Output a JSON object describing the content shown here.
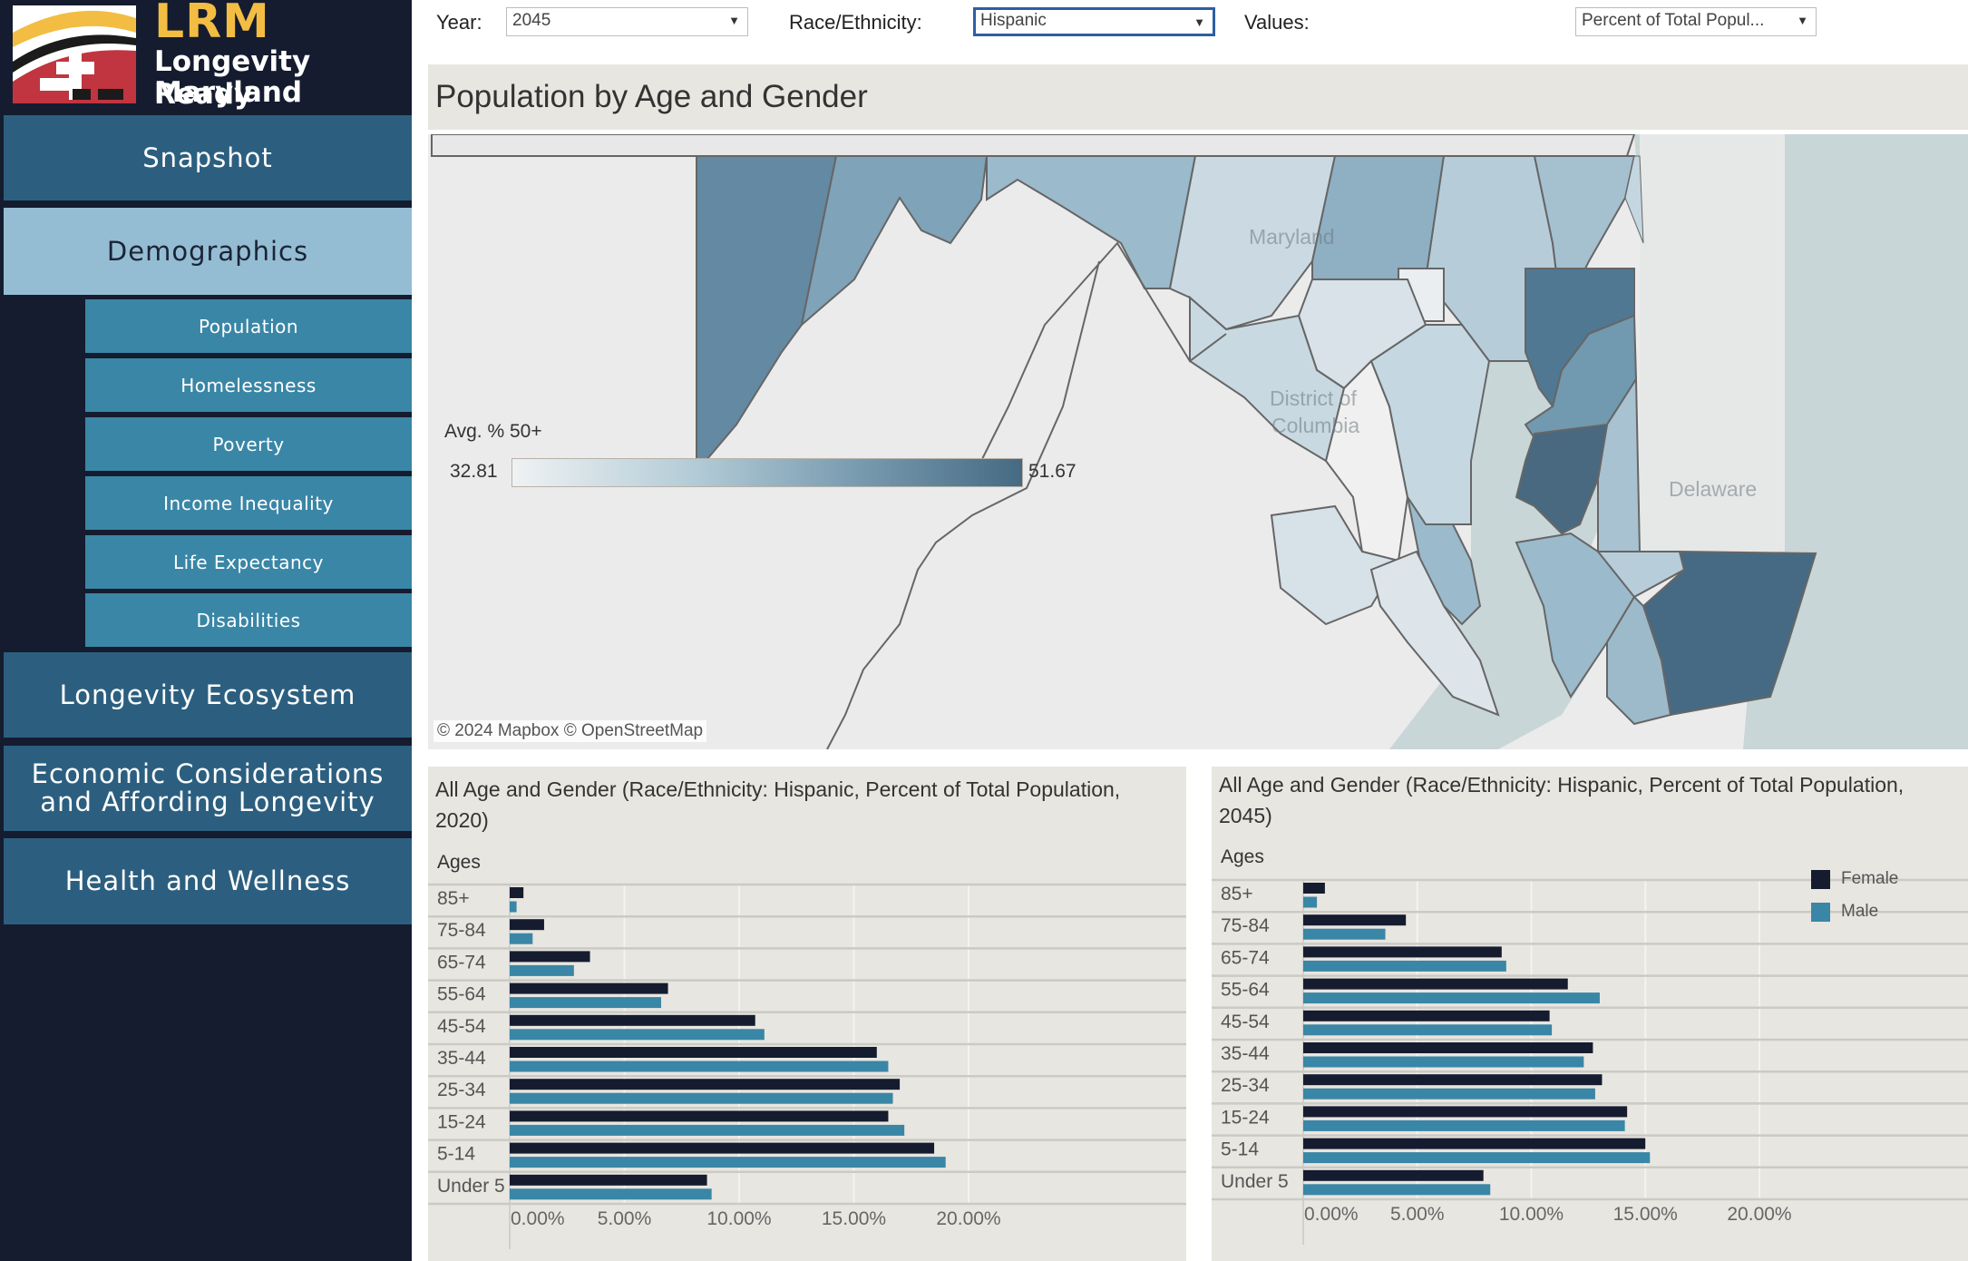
{
  "sidebar": {
    "logo": {
      "acronym": "LRM",
      "line1": "Longevity Ready",
      "line2": "Maryland"
    },
    "nav": [
      {
        "label": "Snapshot",
        "active": false
      },
      {
        "label": "Demographics",
        "active": true
      },
      {
        "label": "Longevity Ecosystem",
        "active": false
      },
      {
        "label": "Economic Considerations and Affording Longevity",
        "active": false
      },
      {
        "label": "Health and Wellness",
        "active": false
      }
    ],
    "subnav": [
      {
        "label": "Population"
      },
      {
        "label": "Homelessness"
      },
      {
        "label": "Poverty"
      },
      {
        "label": "Income Inequality"
      },
      {
        "label": "Life Expectancy"
      },
      {
        "label": "Disabilities"
      }
    ]
  },
  "filters": {
    "year": {
      "label": "Year:",
      "value": "2045"
    },
    "race": {
      "label": "Race/Ethnicity:",
      "value": "Hispanic"
    },
    "values": {
      "label": "Values:",
      "value": "Percent of Total Popul..."
    }
  },
  "page_title": "Population by Age and Gender",
  "map": {
    "legend_title": "Avg. % 50+",
    "legend_min": "32.81",
    "legend_max": "51.67",
    "labels": {
      "maryland": "Maryland",
      "dc1": "District of",
      "dc2": "Columbia",
      "delaware": "Delaware"
    },
    "attribution": "© 2024 Mapbox  © OpenStreetMap",
    "colors": {
      "low": "#eff2f3",
      "high": "#456a83"
    }
  },
  "colors": {
    "female": "#151c2f",
    "male": "#3a86a6"
  },
  "chart_data": [
    {
      "type": "bar",
      "orientation": "horizontal",
      "title": "All Age and Gender (Race/Ethnicity: Hispanic, Percent of Total Population, 2020)",
      "ylabel": "Ages",
      "xlabel": "",
      "categories": [
        "85+",
        "75-84",
        "65-74",
        "55-64",
        "45-54",
        "35-44",
        "25-34",
        "15-24",
        "5-14",
        "Under 5"
      ],
      "series": [
        {
          "name": "Female",
          "values": [
            0.6,
            1.5,
            3.5,
            6.9,
            10.7,
            16.0,
            17.0,
            16.5,
            18.5,
            8.6
          ]
        },
        {
          "name": "Male",
          "values": [
            0.3,
            1.0,
            2.8,
            6.6,
            11.1,
            16.5,
            16.7,
            17.2,
            19.0,
            8.8
          ]
        }
      ],
      "xticks": [
        "0.00%",
        "5.00%",
        "10.00%",
        "15.00%",
        "20.00%"
      ],
      "xlim": [
        0,
        20
      ],
      "grid": true,
      "legend": "none"
    },
    {
      "type": "bar",
      "orientation": "horizontal",
      "title": "All Age and Gender (Race/Ethnicity: Hispanic, Percent of Total Population, 2045)",
      "ylabel": "Ages",
      "xlabel": "",
      "categories": [
        "85+",
        "75-84",
        "65-74",
        "55-64",
        "45-54",
        "35-44",
        "25-34",
        "15-24",
        "5-14",
        "Under 5"
      ],
      "series": [
        {
          "name": "Female",
          "values": [
            0.95,
            4.5,
            8.7,
            11.6,
            10.8,
            12.7,
            13.1,
            14.2,
            15.0,
            7.9
          ]
        },
        {
          "name": "Male",
          "values": [
            0.6,
            3.6,
            8.9,
            13.0,
            10.9,
            12.3,
            12.8,
            14.1,
            15.2,
            8.2
          ]
        }
      ],
      "xticks": [
        "0.00%",
        "5.00%",
        "10.00%",
        "15.00%",
        "20.00%"
      ],
      "xlim": [
        0,
        20
      ],
      "grid": true,
      "legend": "top-right"
    }
  ]
}
